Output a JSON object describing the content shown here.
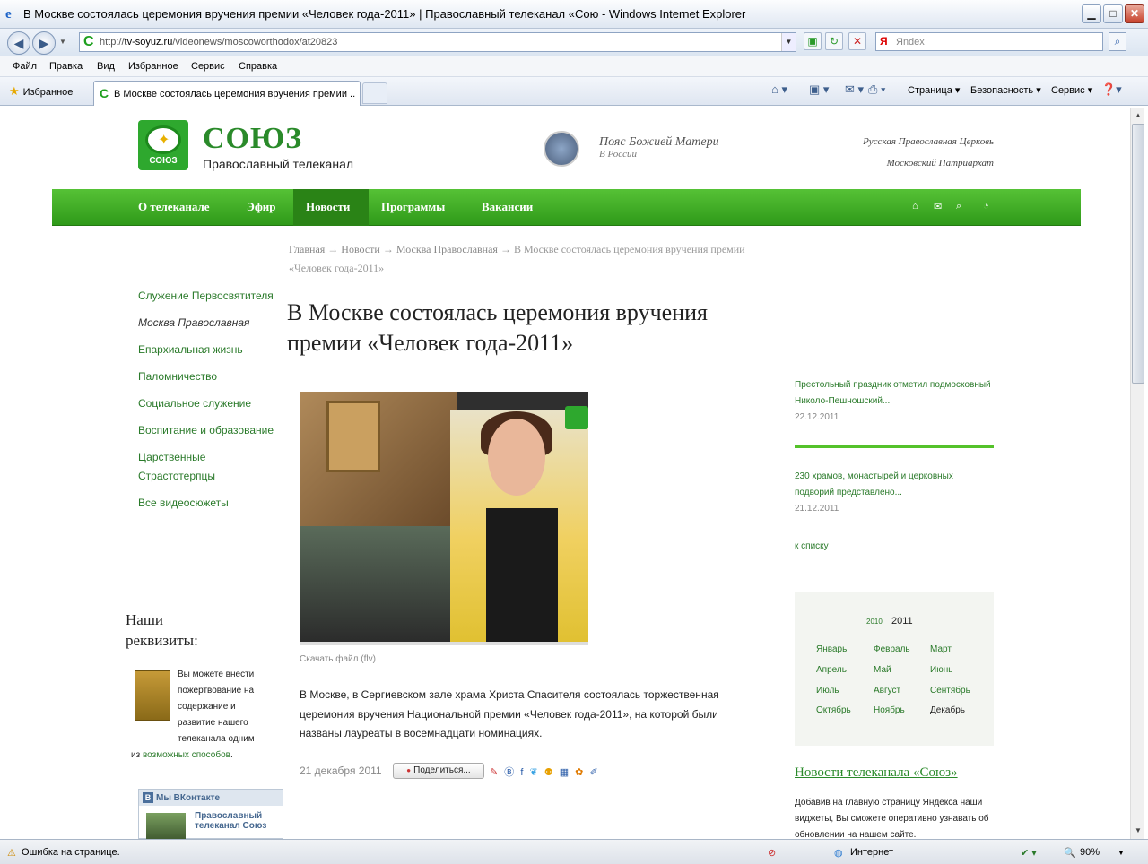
{
  "window": {
    "title": "В Москве состоялась церемония вручения премии «Человек года-2011» | Православный телеканал «Сою - Windows Internet Explorer",
    "url_scheme": "http://",
    "url_host": "tv-soyuz.ru",
    "url_path": "/videonews/moscoworthodox/at20823",
    "search_placeholder": "Яndex",
    "tab_title": "В Москве состоялась церемония вручения премии ...",
    "favorites": "Избранное"
  },
  "menubar": [
    "Файл",
    "Правка",
    "Вид",
    "Избранное",
    "Сервис",
    "Справка"
  ],
  "commandbar": {
    "page": "Страница ▾",
    "safety": "Безопасность ▾",
    "tools": "Сервис ▾"
  },
  "status": {
    "left": "Ошибка на странице.",
    "zone": "Интернет",
    "zoom": "90%"
  },
  "site": {
    "logo_text": "СОЮЗ",
    "name": "СОЮЗ",
    "subtitle": "Православный телеканал",
    "promo_title": "Пояс Божией Матери",
    "promo_sub": "В России",
    "church1": "Русская Православная Церковь",
    "church2": "Московский Патриархат"
  },
  "nav": [
    {
      "label": "О телеканале"
    },
    {
      "label": "Эфир"
    },
    {
      "label": "Новости"
    },
    {
      "label": "Программы"
    },
    {
      "label": "Вакансии"
    }
  ],
  "breadcrumb": {
    "home": "Главная",
    "sep": "→",
    "news": "Новости",
    "section": "Москва Православная",
    "current": "В Москве состоялась церемония вручения премии «Человек года-2011»"
  },
  "sidebar": [
    {
      "label": "Служение Первосвятителя",
      "link": true
    },
    {
      "label": "Москва Православная",
      "link": false
    },
    {
      "label": "Епархиальная жизнь",
      "link": true
    },
    {
      "label": "Паломничество",
      "link": true
    },
    {
      "label": "Социальное служение",
      "link": true
    },
    {
      "label": "Воспитание и образование",
      "link": true
    },
    {
      "label": "Царственные Страстотерпцы",
      "link": true
    },
    {
      "label": "Все видеосюжеты",
      "link": true
    }
  ],
  "article": {
    "title": "В Москве состоялась церемония вручения премии «Человек года-2011»",
    "download": "Скачать файл",
    "download_ext": "(flv)",
    "text": "В Москве, в Сергиевском зале храма Христа Спасителя состоялась торжественная церемония вручения Национальной премии «Человек года-2011», на которой были названы лауреаты в восемнадцати номинациях.",
    "date": "21 декабря 2011",
    "share": "Поделиться..."
  },
  "related": [
    {
      "title": "Престольный праздник отметил подмосковный Николо-Пешношский...",
      "date": "22.12.2011"
    },
    {
      "title": "230 храмов, монастырей и церковных подворий представлено...",
      "date": "21.12.2011"
    }
  ],
  "related_more": "к списку",
  "calendar": {
    "prev_year": "2010",
    "year": "2011",
    "months": [
      "Январь",
      "Февраль",
      "Март",
      "Апрель",
      "Май",
      "Июнь",
      "Июль",
      "Август",
      "Сентябрь",
      "Октябрь",
      "Ноябрь",
      "Декабрь"
    ]
  },
  "yandex": {
    "title": "Новости телеканала «Союз»",
    "text": "Добавив на главную страницу Яндекса наши виджеты, Вы сможете оперативно узнавать об обновлении на нашем сайте."
  },
  "requisites": {
    "title1": "Наши",
    "title2": "реквизиты:",
    "text": "Вы можете внести пожертвование на содержание и развитие нашего телеканала одним из",
    "link": "возможных способов",
    "tail": "."
  },
  "vk": {
    "header": "Мы ВКонтакте",
    "item": "Православный телеканал Союз"
  }
}
